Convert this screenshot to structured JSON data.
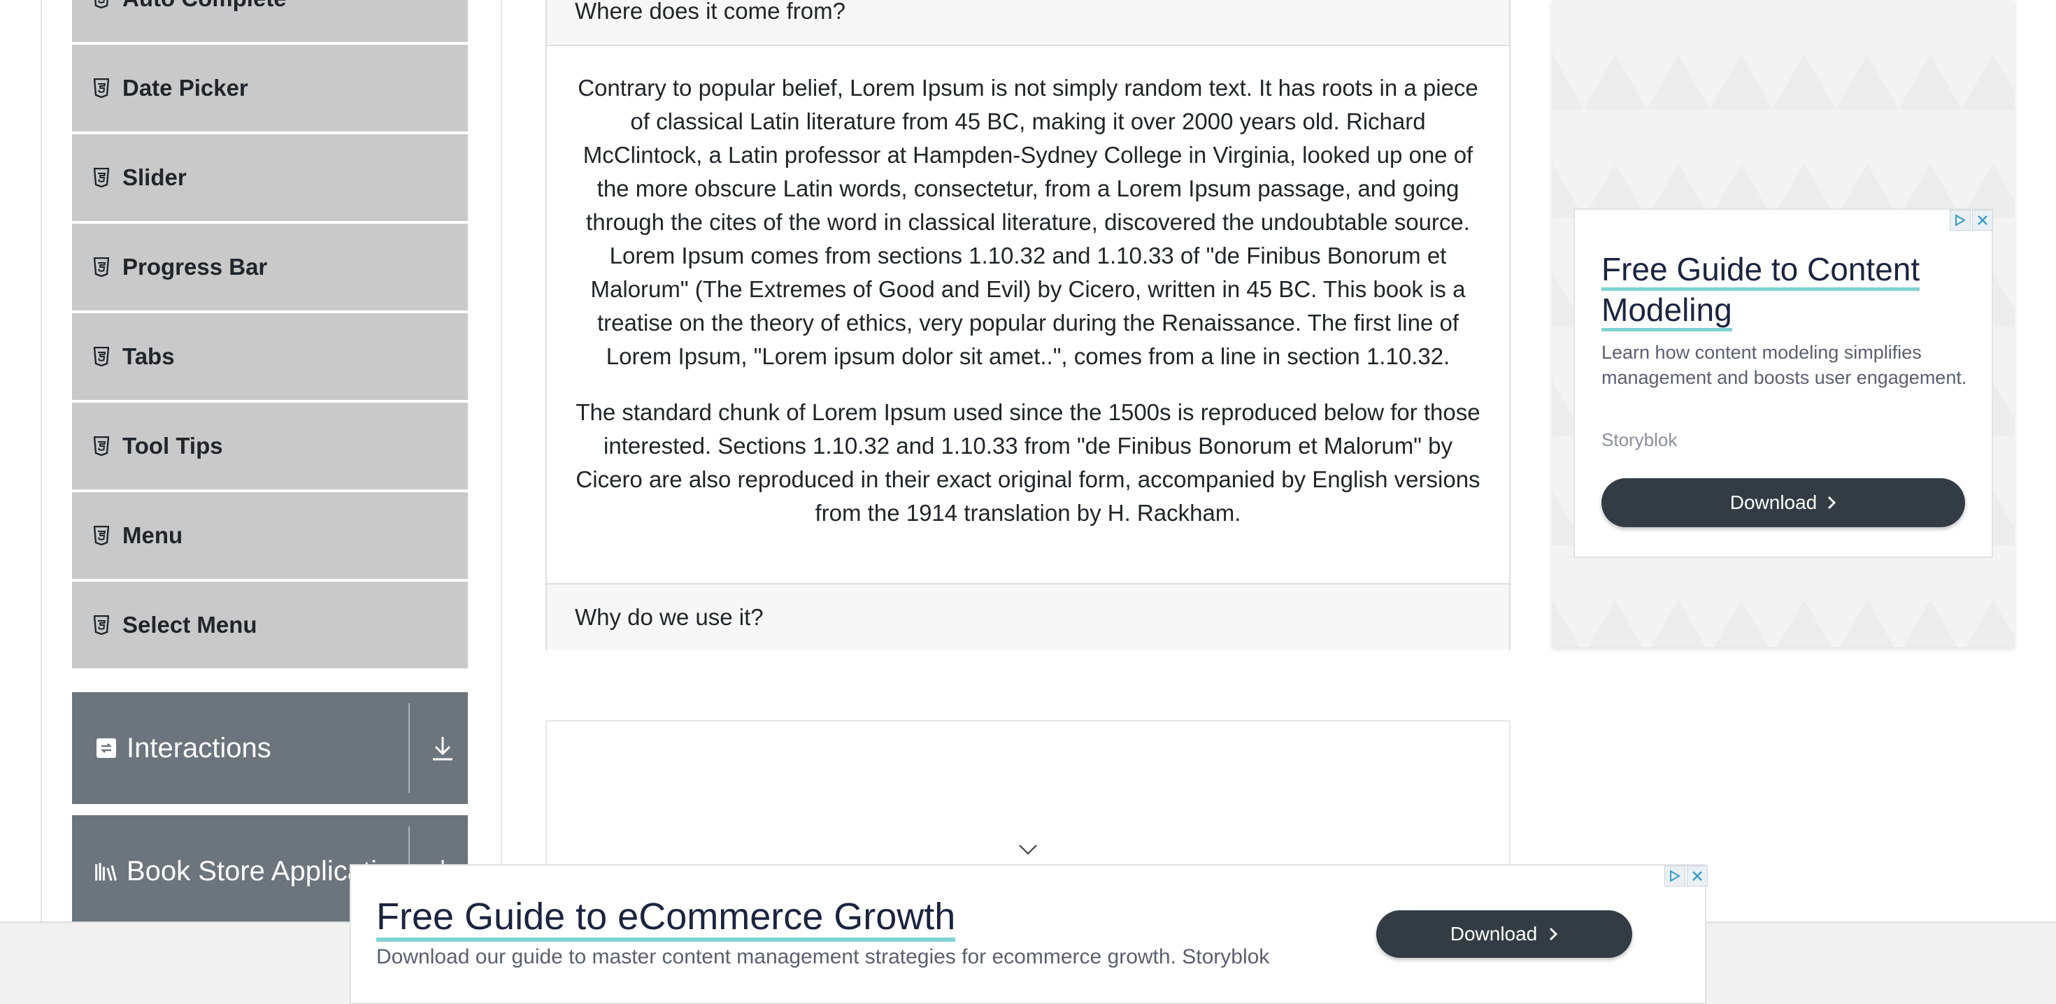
{
  "sidebar": {
    "items": [
      {
        "label": "Auto Complete"
      },
      {
        "label": "Date Picker"
      },
      {
        "label": "Slider"
      },
      {
        "label": "Progress Bar"
      },
      {
        "label": "Tabs"
      },
      {
        "label": "Tool Tips"
      },
      {
        "label": "Menu"
      },
      {
        "label": "Select Menu"
      }
    ],
    "groups": [
      {
        "label": "Interactions"
      },
      {
        "label": "Book Store Application"
      }
    ]
  },
  "accordion": {
    "sections": [
      {
        "header": "Where does it come from?",
        "paragraphs": [
          "Contrary to popular belief, Lorem Ipsum is not simply random text. It has roots in a piece of classical Latin literature from 45 BC, making it over 2000 years old. Richard McClintock, a Latin professor at Hampden-Sydney College in Virginia, looked up one of the more obscure Latin words, consectetur, from a Lorem Ipsum passage, and going through the cites of the word in classical literature, discovered the undoubtable source. Lorem Ipsum comes from sections 1.10.32 and 1.10.33 of \"de Finibus Bonorum et Malorum\" (The Extremes of Good and Evil) by Cicero, written in 45 BC. This book is a treatise on the theory of ethics, very popular during the Renaissance. The first line of Lorem Ipsum, \"Lorem ipsum dolor sit amet..\", comes from a line in section 1.10.32.",
          "The standard chunk of Lorem Ipsum used since the 1500s is reproduced below for those interested. Sections 1.10.32 and 1.10.33 from \"de Finibus Bonorum et Malorum\" by Cicero are also reproduced in their exact original form, accompanied by English versions from the 1914 translation by H. Rackham."
        ]
      },
      {
        "header": "Why do we use it?"
      }
    ]
  },
  "ad_right": {
    "title": "Free Guide to Content Modeling",
    "description": "Learn how content modeling simplifies management and boosts user engagement.",
    "brand": "Storyblok",
    "button": "Download"
  },
  "ad_bottom": {
    "title": "Free Guide to eCommerce Growth",
    "description": "Download our guide to master content management strategies for ecommerce growth. Storyblok",
    "button": "Download"
  },
  "colors": {
    "menu_item_bg": "#c9c9c9",
    "group_header_bg": "#6c757d",
    "ad_button_bg": "#333c44",
    "ad_title_underline": "#7ed3d2"
  }
}
